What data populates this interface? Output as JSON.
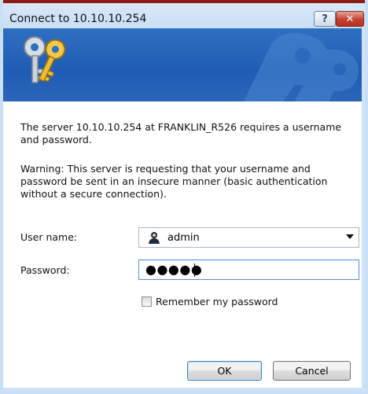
{
  "window": {
    "title": "Connect to 10.10.10.254",
    "help_label": "?",
    "close_label": "✕"
  },
  "message": {
    "server_info": "The server 10.10.10.254 at FRANKLIN_R526 requires a username and password.",
    "warning": "Warning: This server is requesting that your username and password be sent in an insecure manner (basic authentication without a secure connection)."
  },
  "form": {
    "username_label": "User name:",
    "username_value": "admin",
    "password_label": "Password:",
    "password_masked": "●●●●●",
    "remember_label": "Remember my password",
    "remember_checked": false
  },
  "buttons": {
    "ok": "OK",
    "cancel": "Cancel"
  },
  "icons": {
    "banner": "keys-icon",
    "user": "user-icon",
    "dropdown": "chevron-down-icon"
  },
  "colors": {
    "banner": "#1f5cb4",
    "titlebar": "#cfe3f7",
    "close_button": "#c2412f"
  }
}
